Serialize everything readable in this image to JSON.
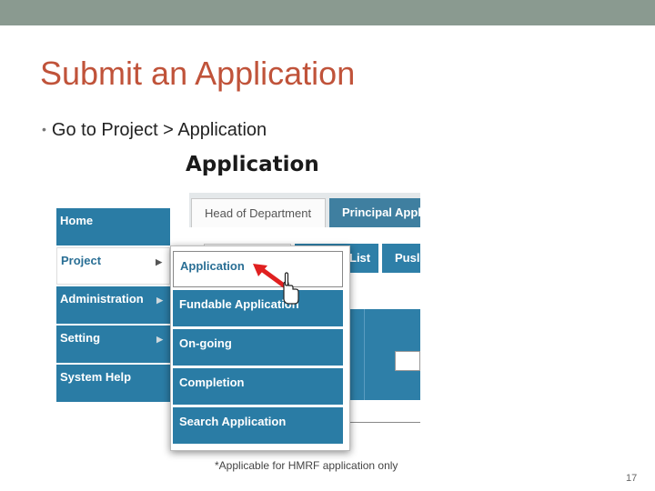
{
  "slide": {
    "title": "Submit an Application",
    "bullet": "Go to Project > Application",
    "page_number": "17"
  },
  "screenshot": {
    "heading": "Application",
    "tabs": [
      {
        "label": "Head of Department",
        "active": true
      },
      {
        "label": "Principal Appl",
        "active": false
      }
    ],
    "subtabs": [
      "",
      "List",
      "Pusl"
    ],
    "nav": [
      {
        "label": "Home"
      },
      {
        "label": "Project",
        "selected": true
      },
      {
        "label": "Administration"
      },
      {
        "label": "Setting"
      },
      {
        "label": "System Help"
      }
    ],
    "dropdown": [
      {
        "label": "Application",
        "highlighted": true
      },
      {
        "label": "Fundable Application"
      },
      {
        "label": "On-going"
      },
      {
        "label": "Completion"
      },
      {
        "label": "Search Application"
      }
    ],
    "note": "*Applicable for HMRF application only"
  },
  "colors": {
    "title": "#c0533a",
    "menu_blue": "#2a7ca5",
    "top_bar": "#8a9a90",
    "annotation_arrow": "#e02020"
  }
}
